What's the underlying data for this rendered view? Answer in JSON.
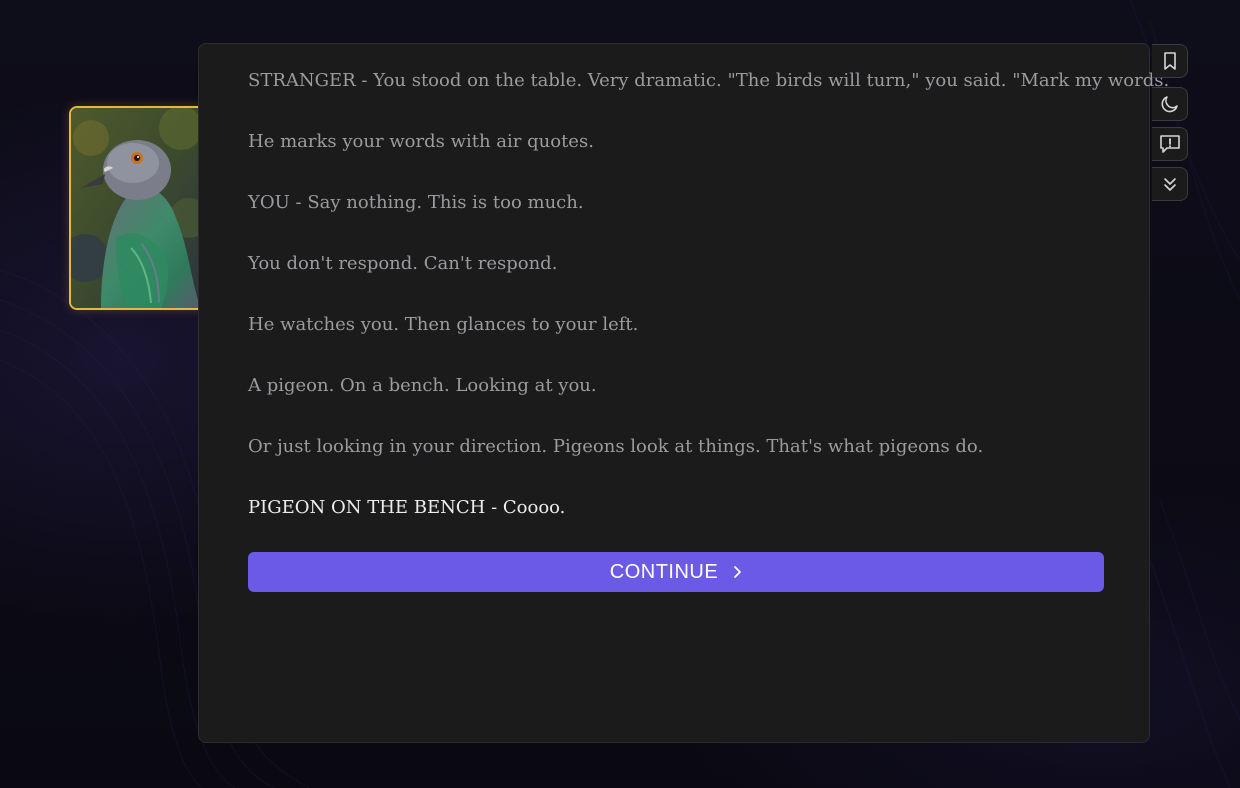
{
  "portrait": {
    "subject": "pigeon",
    "frame_color": "#e2b93b"
  },
  "dialogue": {
    "lines": [
      "STRANGER - You stood on the table. Very dramatic. \"The birds will turn,\" you said. \"Mark my words.\"",
      "He marks your words with air quotes.",
      "YOU - Say nothing. This is too much.",
      "You don't respond. Can't respond.",
      "He watches you. Then glances to your left.",
      "A pigeon. On a bench. Looking at you.",
      "Or just looking in your direction. Pigeons look at things. That's what pigeons do.",
      "PIGEON ON THE BENCH - Coooo."
    ]
  },
  "continue_button": {
    "label": "CONTINUE",
    "icon": "chevron-right-icon",
    "color": "#6b5ae6"
  },
  "toolbar": {
    "tools": [
      {
        "name": "bookmark",
        "icon": "bookmark-icon"
      },
      {
        "name": "dark-mode",
        "icon": "moon-icon"
      },
      {
        "name": "report",
        "icon": "alert-message-icon"
      },
      {
        "name": "skip",
        "icon": "double-chevron-down-icon"
      }
    ]
  },
  "colors": {
    "panel_bg": "#1b1b1c",
    "page_bg": "#0b0a14",
    "text_past": "#9b9ba0",
    "text_current": "#ededee"
  }
}
